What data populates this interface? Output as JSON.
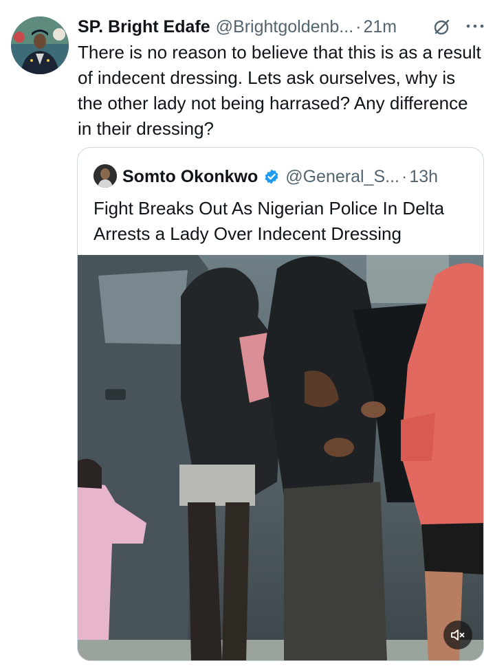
{
  "tweet": {
    "author_name": "SP. Bright Edafe",
    "author_handle": "@Brightgoldenb...",
    "separator": "·",
    "timestamp": "21m",
    "text": "There is no reason to believe that this is as a result of indecent dressing. Lets ask ourselves, why is the other lady not being harrased? Any difference in their dressing?",
    "icons": {
      "avatar": "profile-photo",
      "grok": "grok-icon",
      "more": "more-icon"
    }
  },
  "quoted_tweet": {
    "author_name": "Somto Okonkwo",
    "author_handle": "@General_S...",
    "separator": "·",
    "timestamp": "13h",
    "text": "Fight Breaks Out As Nigerian Police In Delta Arrests a Lady Over Indecent Dressing",
    "icons": {
      "avatar": "profile-photo",
      "verified": "verified-badge-icon",
      "mute": "mute-icon"
    }
  },
  "colors": {
    "text": "#0f1419",
    "secondary": "#536471",
    "border": "#cfd9de",
    "verified": "#1d9bf0"
  }
}
